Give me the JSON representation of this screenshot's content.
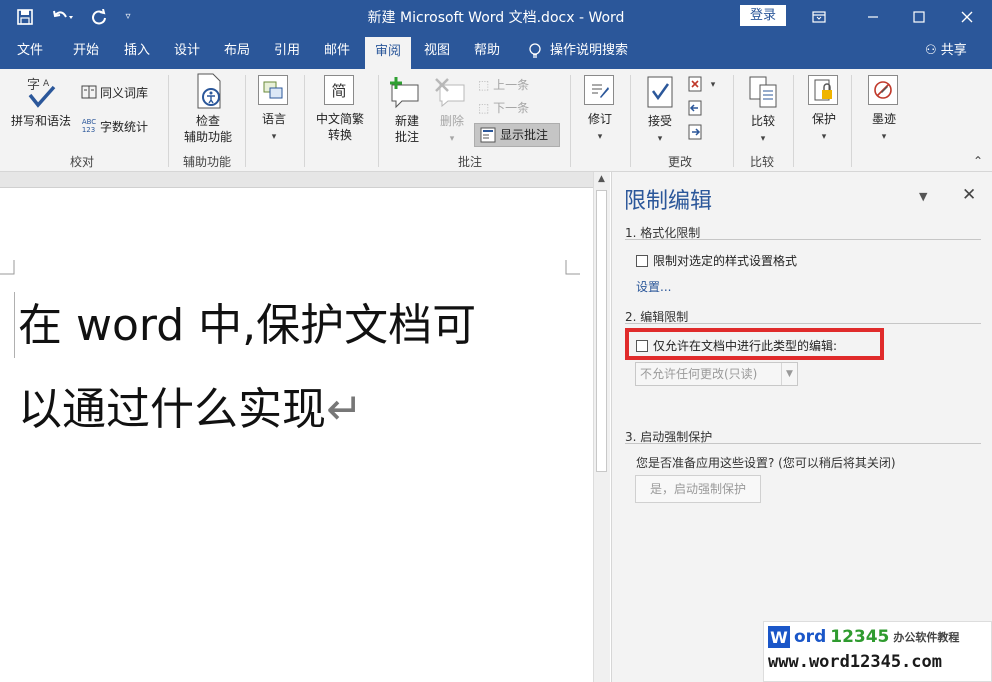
{
  "window": {
    "title": "新建 Microsoft Word 文档.docx - Word",
    "login_label": "登录",
    "save_icon": "save-icon",
    "undo_icon": "undo-icon",
    "redo_icon": "redo-icon",
    "customize_icon": "customize-icon"
  },
  "tabs": [
    {
      "label": "文件"
    },
    {
      "label": "开始"
    },
    {
      "label": "插入"
    },
    {
      "label": "设计"
    },
    {
      "label": "布局"
    },
    {
      "label": "引用"
    },
    {
      "label": "邮件"
    },
    {
      "label": "审阅"
    },
    {
      "label": "视图"
    },
    {
      "label": "帮助"
    }
  ],
  "tell_me": "操作说明搜索",
  "share": "共享",
  "ribbon": {
    "proofing": {
      "spell_label": "拼写和语法",
      "thesaurus_label": "同义词库",
      "wordcount_label": "字数统计",
      "group_label": "校对"
    },
    "accessibility": {
      "check_label_1": "检查",
      "check_label_2": "辅助功能",
      "group_label": "辅助功能"
    },
    "language": {
      "label": "语言"
    },
    "chinese": {
      "label_1": "中文简繁",
      "label_2": "转换",
      "icon_glyph": "简"
    },
    "comments": {
      "new_1": "新建",
      "new_2": "批注",
      "delete_label": "删除",
      "prev_label": "上一条",
      "next_label": "下一条",
      "show_label": "显示批注",
      "group_label": "批注"
    },
    "tracking": {
      "label": "修订"
    },
    "changes": {
      "accept_label": "接受",
      "group_label": "更改"
    },
    "compare": {
      "label": "比较",
      "group_label": "比较"
    },
    "protect": {
      "label": "保护"
    },
    "ink": {
      "label": "墨迹"
    }
  },
  "document": {
    "line1": "在 word 中,保护文档可",
    "line2": "以通过什么实现",
    "return_mark": "↵"
  },
  "pane": {
    "title": "限制编辑",
    "sec1_title": "1. 格式化限制",
    "sec1_checkbox": "限制对选定的样式设置格式",
    "sec1_link": "设置...",
    "sec2_title": "2. 编辑限制",
    "sec2_checkbox": "仅允许在文档中进行此类型的编辑:",
    "sec2_select": "不允许任何更改(只读)",
    "sec3_title": "3. 启动强制保护",
    "sec3_question": "您是否准备应用这些设置? (您可以稍后将其关闭)",
    "sec3_button": "是，启动强制保护"
  },
  "watermark": {
    "w_letter": "W",
    "word_part": "ord",
    "num_part": "12345",
    "sub_text": "办公软件教程",
    "url": "www.word12345.com"
  },
  "colors": {
    "accent": "#2b579a",
    "highlight_red": "#e02b2b"
  }
}
